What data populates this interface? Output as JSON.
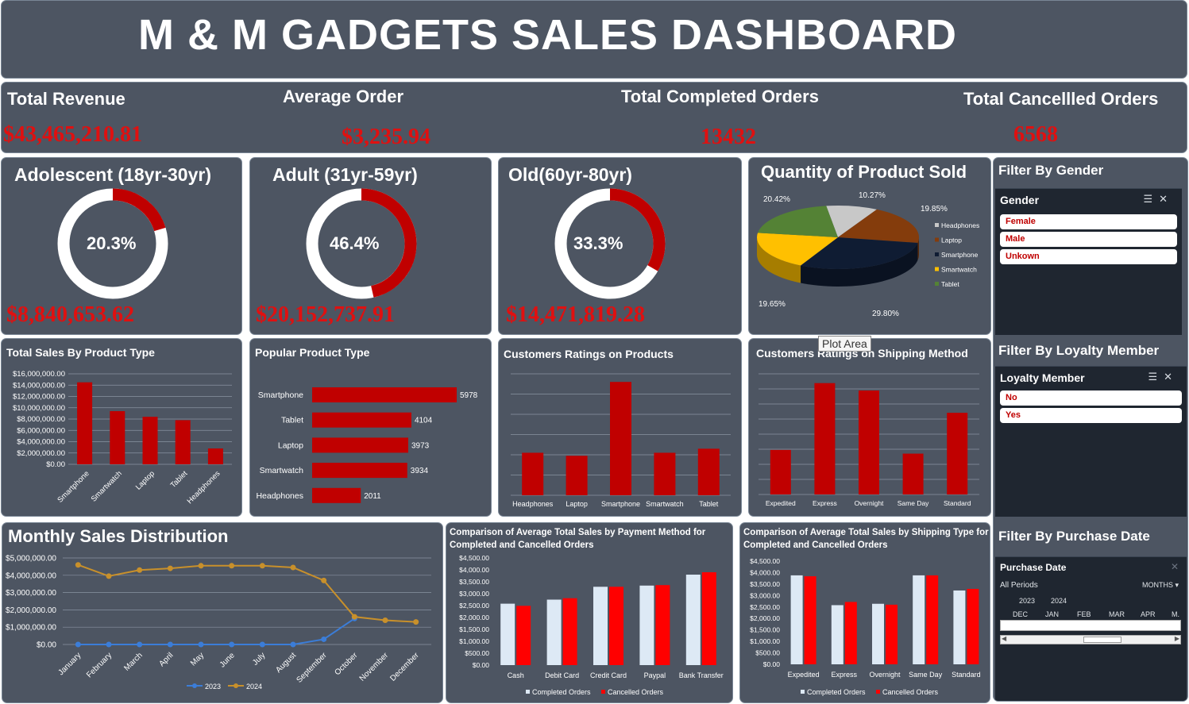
{
  "header": {
    "title": "M & M GADGETS SALES DASHBOARD"
  },
  "kpis": [
    {
      "label": "Total Revenue",
      "value": "$43,465,210.81"
    },
    {
      "label": "Average Order",
      "value": "$3,235.94"
    },
    {
      "label": "Total Completed Orders",
      "value": "13432"
    },
    {
      "label": "Total Cancellled Orders",
      "value": "6568"
    }
  ],
  "age_groups": [
    {
      "label": "Adolescent (18yr-30yr)",
      "percent_label": "20.3%",
      "fraction": 0.203,
      "revenue": "$8,840,653.62"
    },
    {
      "label": "Adult (31yr-59yr)",
      "percent_label": "46.4%",
      "fraction": 0.464,
      "revenue": "$20,152,737.91"
    },
    {
      "label": "Old(60yr-80yr)",
      "percent_label": "33.3%",
      "fraction": 0.333,
      "revenue": "$14,471,819.28"
    }
  ],
  "quantity_pie": {
    "title": "Quantity of Product Sold",
    "tooltip": "Plot Area"
  },
  "filters": {
    "gender": {
      "title": "Filter By Gender",
      "slicer_head": "Gender",
      "options": [
        "Female",
        "Male",
        "Unkown"
      ]
    },
    "loyalty": {
      "title": "Filter By Loyalty Member",
      "slicer_head": "Loyalty Member",
      "options": [
        "No",
        "Yes"
      ]
    },
    "date": {
      "title": "Filter By Purchase Date",
      "slicer_head": "Purchase Date",
      "all_periods": "All Periods",
      "level": "MONTHS",
      "years": [
        "2023",
        "2024"
      ],
      "months": [
        "DEC",
        "JAN",
        "FEB",
        "MAR",
        "APR",
        "M."
      ]
    }
  },
  "colors": {
    "panel": "#4d5562",
    "accent_red": "#c00000",
    "bright_red": "#ff0000",
    "pale_blue": "#dde9f5",
    "orange": "#c8902b",
    "blue": "#3b7dd8"
  },
  "chart_data": [
    {
      "id": "quantity_sold",
      "type": "pie",
      "title": "Quantity of Product Sold",
      "categories": [
        "Headphones",
        "Laptop",
        "Smartphone",
        "Smartwatch",
        "Tablet"
      ],
      "values": [
        10.27,
        19.85,
        29.8,
        19.65,
        20.42
      ],
      "data_labels": [
        "10.27%",
        "19.85%",
        "29.80%",
        "19.65%",
        "20.42%"
      ],
      "colors": [
        "#c8c8c8",
        "#843c0c",
        "#0f1c33",
        "#ffc000",
        "#548235"
      ],
      "legend": "right"
    },
    {
      "id": "sales_by_product",
      "type": "bar",
      "title": "Total Sales By Product Type",
      "categories": [
        "Smartphone",
        "Smartwatch",
        "Laptop",
        "Tablet",
        "Headphones"
      ],
      "values": [
        14500000,
        9400000,
        8400000,
        7800000,
        2800000
      ],
      "ylim": [
        0,
        16000000
      ],
      "yticks": [
        "$0.00",
        "$2,000,000.00",
        "$4,000,000.00",
        "$6,000,000.00",
        "$8,000,000.00",
        "$10,000,000.00",
        "$12,000,000.00",
        "$14,000,000.00",
        "$16,000,000.00"
      ]
    },
    {
      "id": "popular_product",
      "type": "bar",
      "orientation": "horizontal",
      "title": "Popular Product Type",
      "categories": [
        "Smartphone",
        "Tablet",
        "Laptop",
        "Smartwatch",
        "Headphones"
      ],
      "values": [
        5978,
        4104,
        3973,
        3934,
        2011
      ],
      "data_labels": [
        "5978",
        "4104",
        "3973",
        "3934",
        "2011"
      ]
    },
    {
      "id": "ratings_products",
      "type": "bar",
      "title": "Customers Ratings on Products",
      "categories": [
        "Headphones",
        "Laptop",
        "Smartphone",
        "Smartwatch",
        "Tablet"
      ],
      "values": [
        2.1,
        1.95,
        5.6,
        2.1,
        2.3
      ],
      "ylim": [
        0,
        6
      ],
      "grid": true
    },
    {
      "id": "ratings_shipping",
      "type": "bar",
      "title": "Customers Ratings on Shipping Method",
      "categories": [
        "Expedited",
        "Express",
        "Overnight",
        "Same Day",
        "Standard"
      ],
      "values": [
        2.4,
        6.0,
        5.6,
        2.2,
        4.4
      ],
      "ylim": [
        0,
        6.5
      ],
      "grid": true
    },
    {
      "id": "monthly_sales",
      "type": "line",
      "title": "Monthly Sales Distribution",
      "categories": [
        "January",
        "February",
        "March",
        "April",
        "May",
        "June",
        "July",
        "August",
        "September",
        "October",
        "November",
        "December"
      ],
      "series": [
        {
          "name": "2023",
          "values": [
            0,
            0,
            0,
            0,
            0,
            0,
            0,
            0,
            300000,
            1500000,
            null,
            null
          ],
          "color": "#3b7dd8"
        },
        {
          "name": "2024",
          "values": [
            4600000,
            3950000,
            4300000,
            4400000,
            4550000,
            4550000,
            4550000,
            4450000,
            3700000,
            1600000,
            1400000,
            1300000
          ],
          "color": "#c8902b"
        }
      ],
      "ylim": [
        0,
        5000000
      ],
      "yticks": [
        "$0.00",
        "$1,000,000.00",
        "$2,000,000.00",
        "$3,000,000.00",
        "$4,000,000.00",
        "$5,000,000.00"
      ],
      "legend": "bottom"
    },
    {
      "id": "payment_method",
      "type": "bar",
      "title_lines": [
        "Comparison of Average Total Sales by Payment Method for",
        "Completed and Cancelled Orders"
      ],
      "categories": [
        "Cash",
        "Debit Card",
        "Credit Card",
        "Paypal",
        "Bank Transfer"
      ],
      "series": [
        {
          "name": "Completed Orders",
          "values": [
            2580,
            2750,
            3290,
            3340,
            3800
          ],
          "color": "#dde9f5"
        },
        {
          "name": "Cancelled Orders",
          "values": [
            2490,
            2810,
            3290,
            3360,
            3900
          ],
          "color": "#ff0000"
        }
      ],
      "ylim": [
        0,
        4500
      ],
      "yticks": [
        "$0.00",
        "$500.00",
        "$1,000.00",
        "$1,500.00",
        "$2,000.00",
        "$2,500.00",
        "$3,000.00",
        "$3,500.00",
        "$4,000.00",
        "$4,500.00"
      ],
      "legend": "bottom"
    },
    {
      "id": "shipping_type",
      "type": "bar",
      "title_lines": [
        "Comparison of Average Total Sales by Shipping Type for",
        "Completed and Cancelled Orders"
      ],
      "categories": [
        "Expedited",
        "Express",
        "Overnight",
        "Same Day",
        "Standard"
      ],
      "series": [
        {
          "name": "Completed Orders",
          "values": [
            3880,
            2580,
            2640,
            3880,
            3220
          ],
          "color": "#dde9f5"
        },
        {
          "name": "Cancelled Orders",
          "values": [
            3840,
            2720,
            2600,
            3880,
            3290
          ],
          "color": "#ff0000"
        }
      ],
      "ylim": [
        0,
        4500
      ],
      "yticks": [
        "$0.00",
        "$500.00",
        "$1,000.00",
        "$1,500.00",
        "$2,000.00",
        "$2,500.00",
        "$3,000.00",
        "$3,500.00",
        "$4,000.00",
        "$4,500.00"
      ],
      "legend": "bottom"
    }
  ]
}
